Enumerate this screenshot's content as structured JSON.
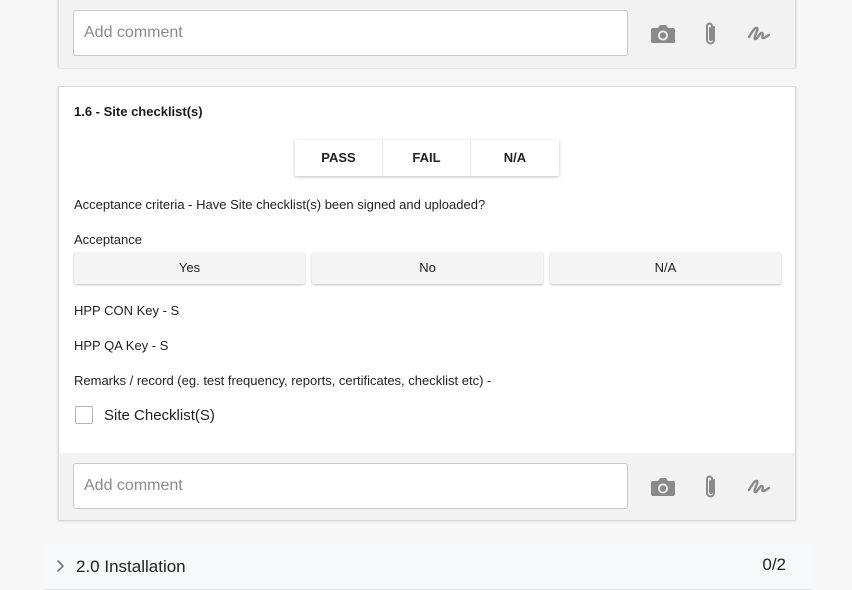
{
  "top_card": {
    "comment_placeholder": "Add comment"
  },
  "section": {
    "title": "1.6 - Site checklist(s)",
    "result_buttons": [
      "PASS",
      "FAIL",
      "N/A"
    ],
    "acceptance_criteria": "Acceptance criteria - Have Site checklist(s) been signed and uploaded?",
    "acceptance_label": "Acceptance",
    "acceptance_options": [
      "Yes",
      "No",
      "N/A"
    ],
    "con_key": "HPP CON Key - S",
    "qa_key": "HPP QA Key - S",
    "remarks": "Remarks / record (eg. test frequency, reports, certificates, checklist etc) -",
    "checkbox_label": "Site Checklist(S)",
    "checkbox_checked": false,
    "comment_placeholder": "Add comment"
  },
  "installation": {
    "title": "2.0 Installation",
    "count": "0/2"
  },
  "icons": {
    "camera": "camera-icon",
    "attach": "paperclip-icon",
    "signature": "signature-icon",
    "chevron": "chevron-right-icon"
  },
  "colors": {
    "icon": "#8a8a8a",
    "bar_bg": "#f2f2f2"
  }
}
